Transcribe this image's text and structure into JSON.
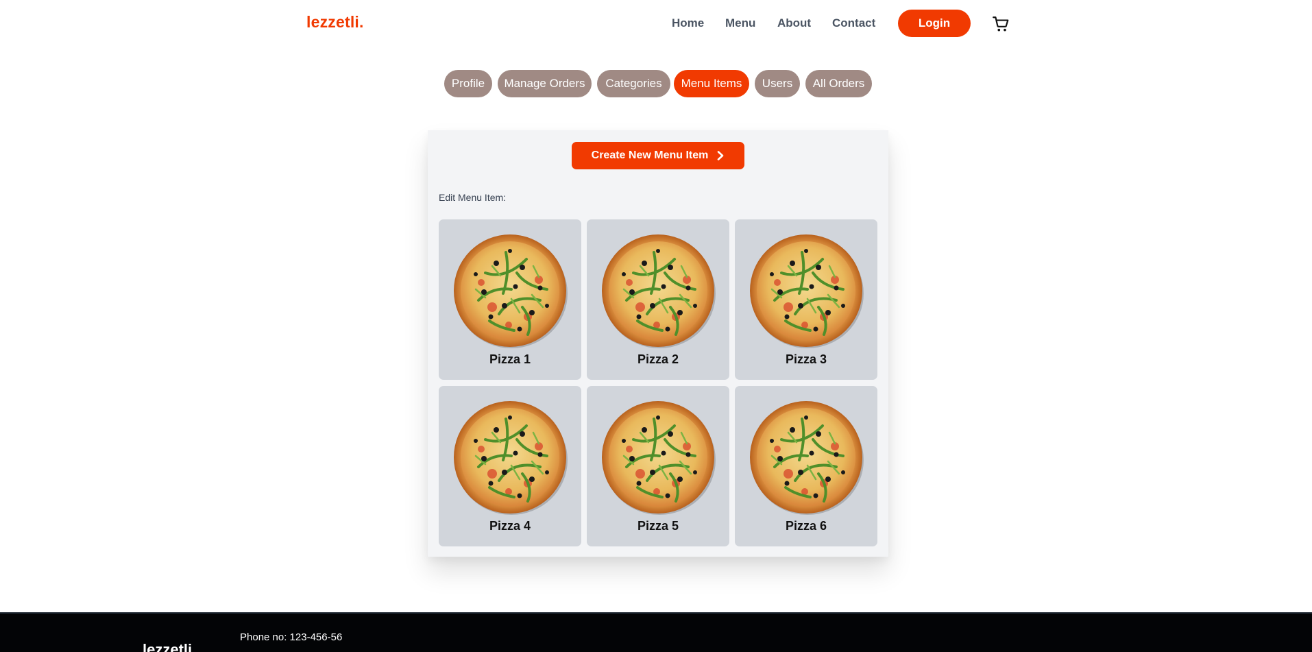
{
  "brand": {
    "logo": "lezzetli.",
    "accent_color": "#f13a01"
  },
  "nav": {
    "links": [
      "Home",
      "Menu",
      "About",
      "Contact"
    ],
    "login_label": "Login",
    "cart_icon": "cart-icon"
  },
  "tabs": {
    "items": [
      "Profile",
      "Manage Orders",
      "Categories",
      "Menu Items",
      "Users",
      "All Orders"
    ],
    "active": "Menu Items",
    "inactive_color": "#a08a84"
  },
  "panel": {
    "create_button_label": "Create New Menu Item",
    "create_button_icon": "chevron-right-icon",
    "edit_label": "Edit Menu Item:",
    "items": [
      {
        "name": "Pizza 1",
        "image_icon": "pizza-image"
      },
      {
        "name": "Pizza 2",
        "image_icon": "pizza-image"
      },
      {
        "name": "Pizza 3",
        "image_icon": "pizza-image"
      },
      {
        "name": "Pizza 4",
        "image_icon": "pizza-image"
      },
      {
        "name": "Pizza 5",
        "image_icon": "pizza-image"
      },
      {
        "name": "Pizza 6",
        "image_icon": "pizza-image"
      }
    ]
  },
  "footer": {
    "phone": "Phone no: 123-456-56",
    "brand": "lezzetli."
  }
}
